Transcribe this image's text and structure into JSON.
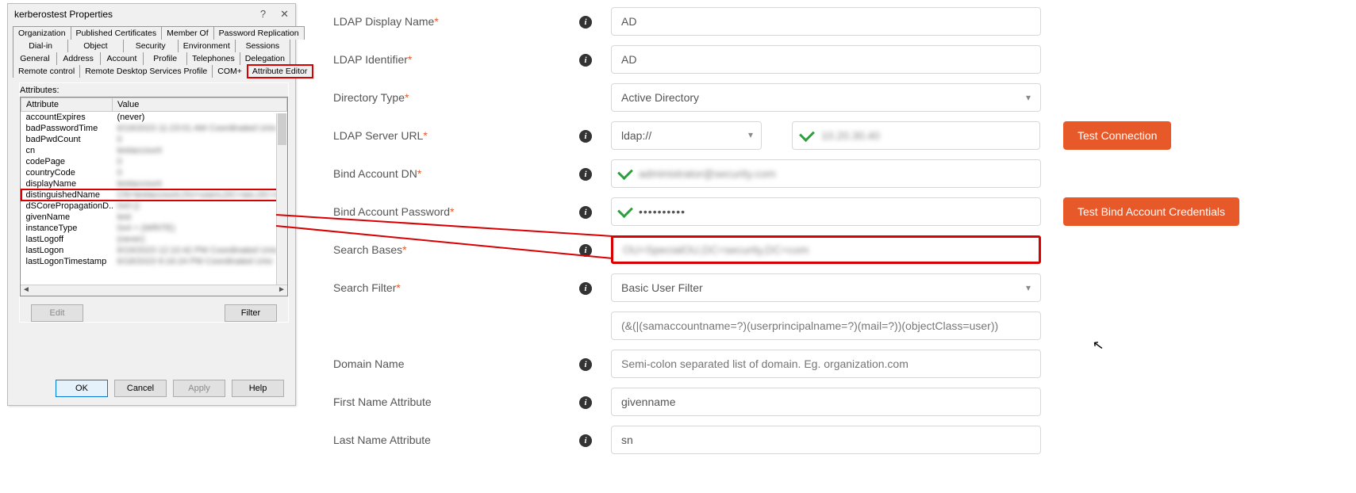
{
  "dialog": {
    "title": "kerberostest Properties",
    "help_glyph": "?",
    "close_glyph": "✕",
    "tabs_row1": [
      "Organization",
      "Published Certificates",
      "Member Of",
      "Password Replication"
    ],
    "tabs_row2": [
      "Dial-in",
      "Object",
      "Security",
      "Environment",
      "Sessions"
    ],
    "tabs_row3": [
      "General",
      "Address",
      "Account",
      "Profile",
      "Telephones",
      "Delegation"
    ],
    "tabs_row4": [
      "Remote control",
      "Remote Desktop Services Profile",
      "COM+",
      "Attribute Editor"
    ],
    "attributes_label": "Attributes:",
    "col_attr": "Attribute",
    "col_val": "Value",
    "rows": [
      {
        "a": "accountExpires",
        "v": "(never)",
        "blur": false
      },
      {
        "a": "badPasswordTime",
        "v": "6/19/2023 11:23:01 AM Coordinated Univ",
        "blur": true
      },
      {
        "a": "badPwdCount",
        "v": "0",
        "blur": true
      },
      {
        "a": "cn",
        "v": "testaccount",
        "blur": true
      },
      {
        "a": "codePage",
        "v": "0",
        "blur": true
      },
      {
        "a": "countryCode",
        "v": "0",
        "blur": true
      },
      {
        "a": "displayName",
        "v": "testaccount",
        "blur": true
      },
      {
        "a": "distinguishedName",
        "v": "CN=testaccount,OU=users,DC=sec,DC=com",
        "blur": true,
        "hl": true
      },
      {
        "a": "dSCorePropagationD...",
        "v": "0x0 ()",
        "blur": true
      },
      {
        "a": "givenName",
        "v": "test",
        "blur": true
      },
      {
        "a": "instanceType",
        "v": "0x4 = (WRITE)",
        "blur": true
      },
      {
        "a": "lastLogoff",
        "v": "(never)",
        "blur": true
      },
      {
        "a": "lastLogon",
        "v": "6/19/2023 12:10:42 PM Coordinated Univ",
        "blur": true
      },
      {
        "a": "lastLogonTimestamp",
        "v": "6/18/2023 9:16:24 PM Coordinated Univ",
        "blur": true
      }
    ],
    "btn_edit": "Edit",
    "btn_filter": "Filter",
    "btn_ok": "OK",
    "btn_cancel": "Cancel",
    "btn_apply": "Apply",
    "btn_help": "Help"
  },
  "form": {
    "ldap_display_name_label": "LDAP Display Name",
    "ldap_display_name_value": "AD",
    "ldap_identifier_label": "LDAP Identifier",
    "ldap_identifier_value": "AD",
    "directory_type_label": "Directory Type",
    "directory_type_value": "Active Directory",
    "server_url_label": "LDAP Server URL",
    "server_url_protocol": "ldap://",
    "server_url_host": "10.20.30.40",
    "btn_test_connection": "Test Connection",
    "bind_dn_label": "Bind Account DN",
    "bind_dn_value": "administrator@security.com",
    "bind_pw_label": "Bind Account Password",
    "bind_pw_value": "••••••••••",
    "btn_test_bind": "Test Bind Account Credentials",
    "search_bases_label": "Search Bases",
    "search_bases_value": "OU=SpecialOU,DC=security,DC=com",
    "search_filter_label": "Search Filter",
    "search_filter_value": "Basic User Filter",
    "search_filter_expr": "(&(|(samaccountname=?)(userprincipalname=?)(mail=?))(objectClass=user))",
    "domain_name_label": "Domain Name",
    "domain_name_placeholder": "Semi-colon separated list of domain. Eg. organization.com",
    "first_name_attr_label": "First Name Attribute",
    "first_name_attr_value": "givenname",
    "last_name_attr_label": "Last Name Attribute",
    "last_name_attr_value": "sn"
  }
}
